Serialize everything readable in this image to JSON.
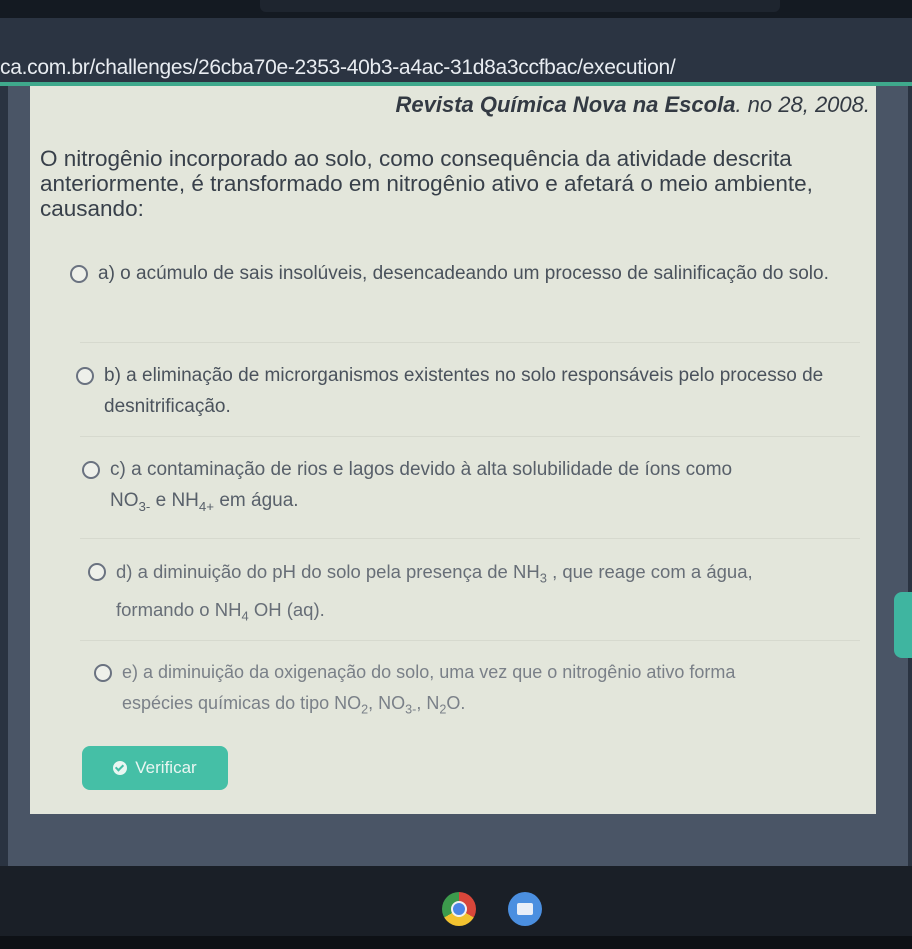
{
  "browser": {
    "url": "ca.com.br/challenges/26cba70e-2353-40b3-a4ac-31d8a3ccfbac/execution/"
  },
  "citation": {
    "source": "Revista Química Nova na Escola",
    "details": ". no 28, 2008."
  },
  "question": {
    "text": "O nitrogênio incorporado ao solo, como consequência da atividade descrita anteriormente, é transformado em nitrogênio ativo e afetará o meio ambiente, causando:"
  },
  "options": {
    "a": {
      "text": "a) o acúmulo de sais insolúveis, desencadeando um processo de salinificação do solo."
    },
    "b": {
      "text": "b) a eliminação de microrganismos existentes no solo responsáveis pelo processo de desnitrificação."
    },
    "c": {
      "text": "c) a contaminação de rios e lagos devido à alta solubilidade de íons como",
      "f1": "NO",
      "f1_sub": "3-",
      "joiner": " e ",
      "f2": "NH",
      "f2_sub": "4+",
      "tail": " em água."
    },
    "d": {
      "text": "d) a diminuição do pH do solo pela presença de ",
      "f1": "NH",
      "f1_sub": "3",
      "mid": ", que reage com a água,",
      "pre2": "formando o ",
      "f2": "NH",
      "f2_sub": "4",
      "tail": "OH (aq)."
    },
    "e": {
      "text": "e) a diminuição da oxigenação do solo, uma vez que o nitrogênio ativo forma",
      "pre": "espécies químicas do tipo ",
      "f1": "NO",
      "f1_sub": "2",
      "sep1": ", ",
      "f2": "NO",
      "f2_sub": "3-",
      "sep2": ", ",
      "f3": "N",
      "f3_sub": "2",
      "f3_tail": "O."
    }
  },
  "actions": {
    "verify_label": "Verificar"
  },
  "colors": {
    "accent": "#45bfa6",
    "card_bg": "#e3e6db",
    "page_bg": "#2a3341"
  }
}
